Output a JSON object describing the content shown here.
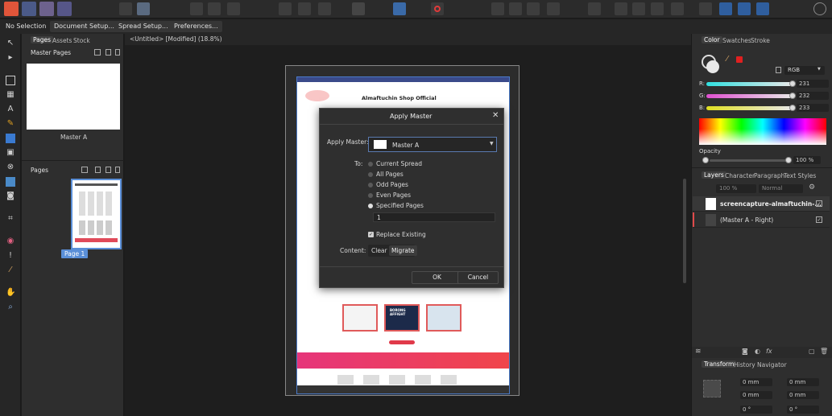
{
  "context_bar": {
    "selection": "No Selection",
    "document_setup": "Document Setup...",
    "spread_setup": "Spread Setup...",
    "preferences": "Preferences..."
  },
  "document_title": "<Untitled> [Modified] (18.8%)",
  "pages_panel": {
    "tabs": [
      "Pages",
      "Assets",
      "Stock"
    ],
    "master_pages_label": "Master Pages",
    "master_a_label": "Master A",
    "pages_label": "Pages",
    "page_1_label": "Page 1"
  },
  "page_preview": {
    "shop_title": "Almaftuchin Shop Official",
    "promo_title": "BORONG AFFIGHT"
  },
  "dialog": {
    "title": "Apply Master",
    "apply_master_label": "Apply Master:",
    "apply_master_value": "Master A",
    "to_label": "To:",
    "options": [
      {
        "label": "Current Spread",
        "selected": false
      },
      {
        "label": "All Pages",
        "selected": false
      },
      {
        "label": "Odd Pages",
        "selected": false
      },
      {
        "label": "Even Pages",
        "selected": false
      },
      {
        "label": "Specified Pages",
        "selected": true
      }
    ],
    "specified_pages_value": "1",
    "replace_existing_label": "Replace Existing",
    "replace_existing_checked": true,
    "content_label": "Content:",
    "content_options": [
      "Clear",
      "Migrate"
    ],
    "content_selected": "Migrate",
    "ok": "OK",
    "cancel": "Cancel"
  },
  "color_panel": {
    "tabs": [
      "Color",
      "Swatches",
      "Stroke"
    ],
    "mode": "RGB",
    "r_label": "R:",
    "r": "231",
    "g_label": "G:",
    "g": "232",
    "b_label": "B:",
    "b": "233",
    "opacity_label": "Opacity",
    "opacity": "100 %",
    "colors": {
      "r_track": "#e05a8a",
      "g_track": "#e07ad0",
      "b_track": "#d8c820"
    }
  },
  "layers_panel": {
    "tabs": [
      "Layers",
      "Character",
      "Paragraph",
      "Text Styles"
    ],
    "opacity": "100 %",
    "blend": "Normal",
    "layers": [
      {
        "name": "screencapture-almaftuchin-...",
        "checked": true
      },
      {
        "name": "(Master A - Right)",
        "checked": true
      }
    ]
  },
  "transform_panel": {
    "tabs": [
      "Transform",
      "History",
      "Navigator"
    ],
    "x": "0 mm",
    "y": "0 mm",
    "w": "0 mm",
    "h": "0 mm",
    "r": "0 °",
    "s": "0 °"
  }
}
